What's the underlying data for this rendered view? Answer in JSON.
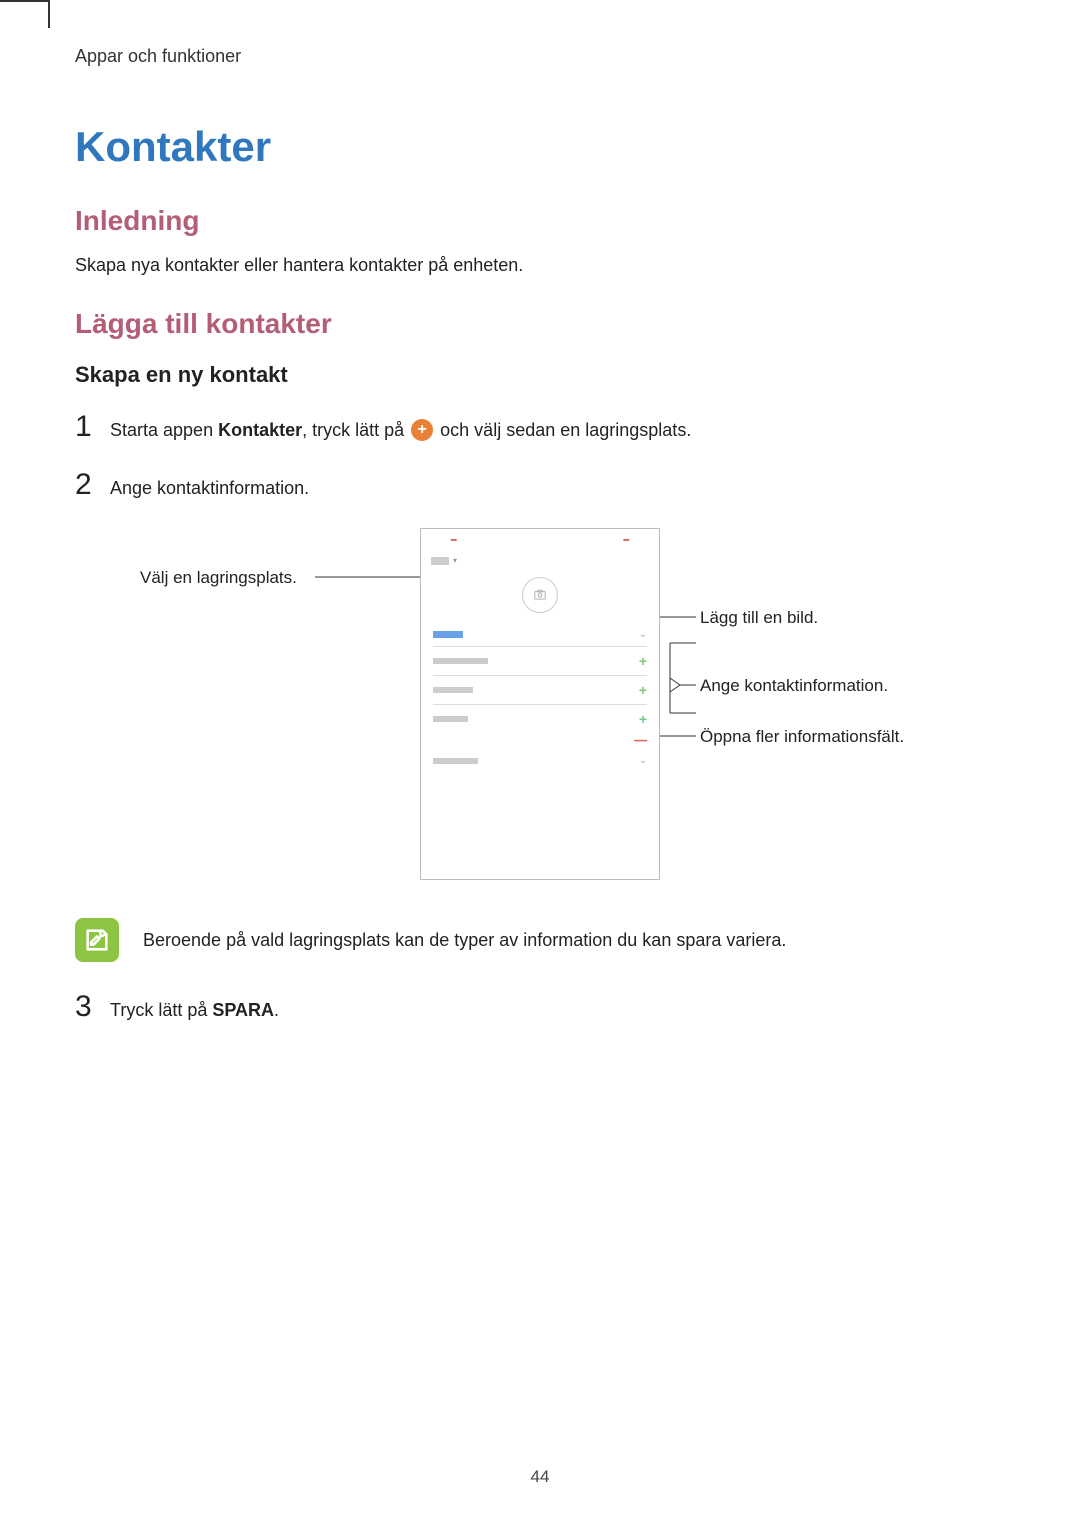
{
  "header": {
    "breadcrumb": "Appar och funktioner"
  },
  "title": "Kontakter",
  "section_intro": {
    "heading": "Inledning",
    "body": "Skapa nya kontakter eller hantera kontakter på enheten."
  },
  "section_add": {
    "heading": "Lägga till kontakter",
    "sub": "Skapa en ny kontakt",
    "steps": {
      "s1_num": "1",
      "s1_a": "Starta appen ",
      "s1_b_bold": "Kontakter",
      "s1_c": ", tryck lätt på ",
      "s1_d": " och välj sedan en lagringsplats.",
      "s2_num": "2",
      "s2_text": "Ange kontaktinformation.",
      "s3_num": "3",
      "s3_a": "Tryck lätt på ",
      "s3_b_bold": "SPARA",
      "s3_c": "."
    },
    "callouts": {
      "left": "Välj en lagringsplats.",
      "r1": "Lägg till en bild.",
      "r2": "Ange kontaktinformation.",
      "r3": "Öppna fler informationsfält."
    },
    "note": "Beroende på vald lagringsplats kan de typer av information du kan spara variera."
  },
  "page_number": "44"
}
